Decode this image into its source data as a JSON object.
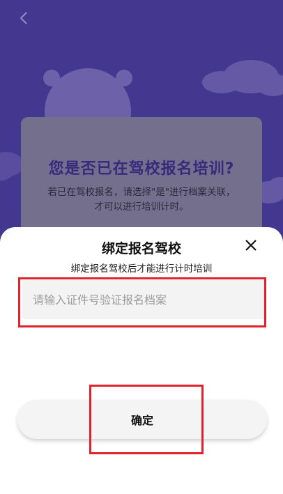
{
  "background": {
    "back_icon": "chevron-left-icon",
    "card": {
      "title": "您是否已在驾校报名培训?",
      "desc_line1": "若已在驾校报名，请选择\"是\"进行档案关联，",
      "desc_line2": "才可以进行培训计时。"
    },
    "colors": {
      "background": "#4e3fa6",
      "title": "#3d2e8c"
    }
  },
  "sheet": {
    "title": "绑定报名驾校",
    "subtitle": "绑定报名驾校后才能进行计时培训",
    "close_icon": "close-icon",
    "id_input": {
      "value": "",
      "placeholder": "请输入证件号验证报名档案"
    },
    "confirm_label": "确定",
    "highlight_color": "#e1222a"
  }
}
